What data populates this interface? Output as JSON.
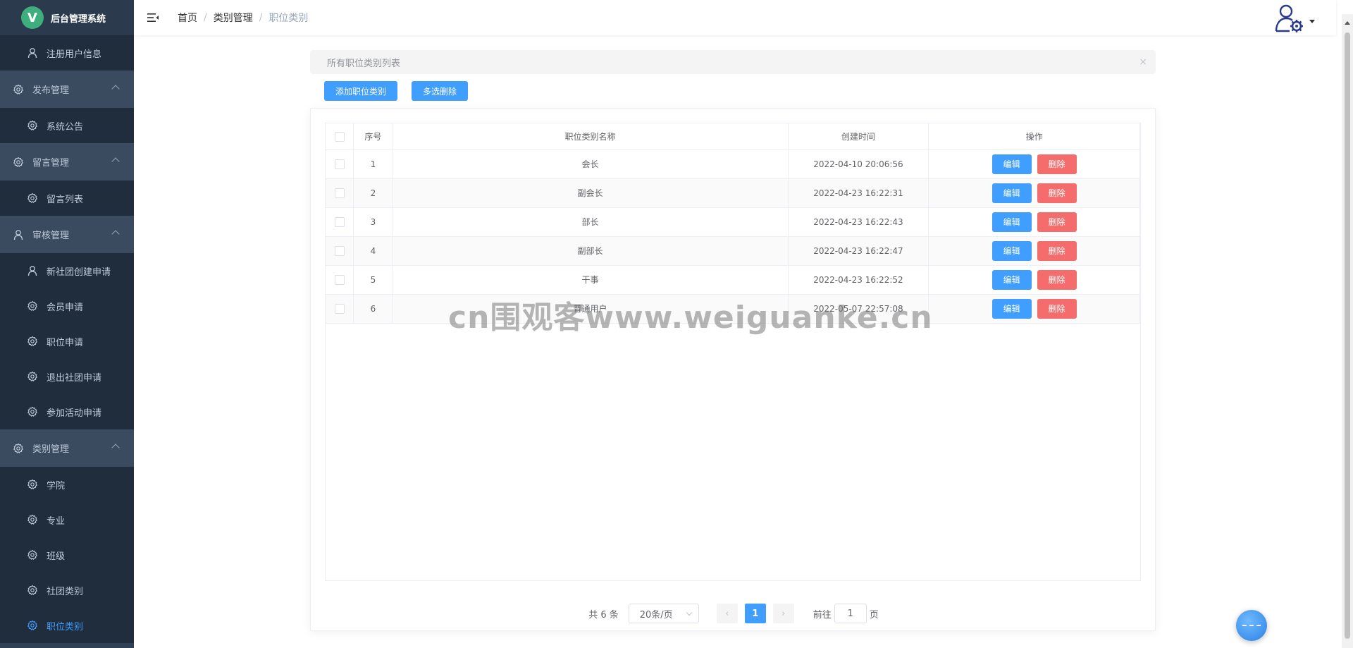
{
  "app": {
    "logo_letter": "V",
    "title": "后台管理系统"
  },
  "sidebar": {
    "items": [
      {
        "type": "sub",
        "label": "注册用户信息",
        "icon": "user-icon"
      },
      {
        "type": "group",
        "label": "发布管理",
        "icon": "gear-icon"
      },
      {
        "type": "sub",
        "label": "系统公告",
        "icon": "gear-icon"
      },
      {
        "type": "group",
        "label": "留言管理",
        "icon": "gear-icon"
      },
      {
        "type": "sub",
        "label": "留言列表",
        "icon": "gear-icon"
      },
      {
        "type": "group",
        "label": "审核管理",
        "icon": "user-icon"
      },
      {
        "type": "sub",
        "label": "新社团创建申请",
        "icon": "user-icon"
      },
      {
        "type": "sub",
        "label": "会员申请",
        "icon": "gear-icon"
      },
      {
        "type": "sub",
        "label": "职位申请",
        "icon": "gear-icon"
      },
      {
        "type": "sub",
        "label": "退出社团申请",
        "icon": "gear-icon"
      },
      {
        "type": "sub",
        "label": "参加活动申请",
        "icon": "gear-icon"
      },
      {
        "type": "group",
        "label": "类别管理",
        "icon": "gear-icon"
      },
      {
        "type": "sub",
        "label": "学院",
        "icon": "gear-icon"
      },
      {
        "type": "sub",
        "label": "专业",
        "icon": "gear-icon"
      },
      {
        "type": "sub",
        "label": "班级",
        "icon": "gear-icon"
      },
      {
        "type": "sub",
        "label": "社团类别",
        "icon": "gear-icon"
      },
      {
        "type": "sub",
        "label": "职位类别",
        "icon": "gear-icon",
        "active": true
      }
    ]
  },
  "breadcrumb": {
    "home": "首页",
    "parent": "类别管理",
    "current": "职位类别"
  },
  "alert": {
    "text": "所有职位类别列表",
    "close": "×"
  },
  "toolbar": {
    "add_label": "添加职位类别",
    "multi_delete_label": "多选删除"
  },
  "table": {
    "headers": {
      "index": "序号",
      "name": "职位类别名称",
      "created": "创建时间",
      "ops": "操作"
    },
    "edit_label": "编辑",
    "delete_label": "删除",
    "rows": [
      {
        "index": "1",
        "name": "会长",
        "created": "2022-04-10 20:06:56"
      },
      {
        "index": "2",
        "name": "副会长",
        "created": "2022-04-23 16:22:31"
      },
      {
        "index": "3",
        "name": "部长",
        "created": "2022-04-23 16:22:43"
      },
      {
        "index": "4",
        "name": "副部长",
        "created": "2022-04-23 16:22:47"
      },
      {
        "index": "5",
        "name": "干事",
        "created": "2022-04-23 16:22:52"
      },
      {
        "index": "6",
        "name": "普通用户",
        "created": "2022-05-07 22:57:08"
      }
    ]
  },
  "pagination": {
    "total": "共 6 条",
    "page_size": "20条/页",
    "current_page": "1",
    "goto_prefix": "前往",
    "goto_value": "1",
    "goto_suffix": "页"
  },
  "watermark": "cn围观客www.weiguanke.cn",
  "colors": {
    "sidebar_bg": "#304156",
    "primary": "#409eff",
    "danger": "#f56c6c",
    "active_menu": "#409eff"
  }
}
